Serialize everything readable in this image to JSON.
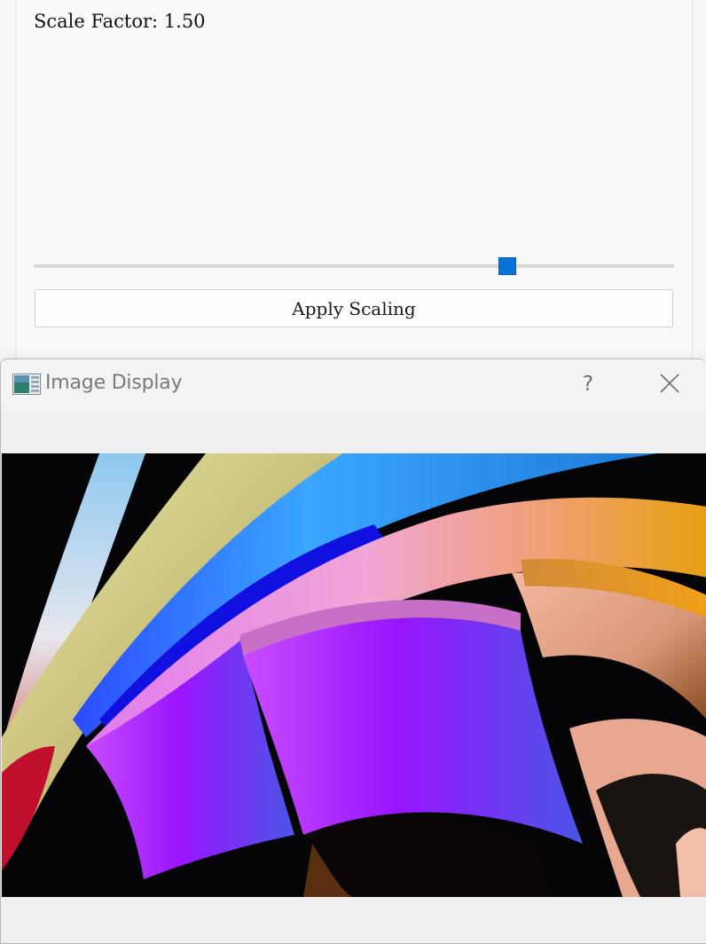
{
  "main_window": {
    "scale_label": "Scale Factor: 1.50",
    "slider": {
      "value": 1.5,
      "fraction": 0.74
    },
    "apply_button_label": "Apply Scaling"
  },
  "dialog": {
    "title": "Image Display",
    "help_label": "?",
    "close_icon": "close-icon",
    "app_icon": "image-app-icon",
    "image_description_icon": "abstract-colorful-ribbons-image"
  },
  "colors": {
    "accent": "#0a72d4",
    "window_bg": "#f9f9f9",
    "dialog_bg": "#f0f0f0"
  }
}
